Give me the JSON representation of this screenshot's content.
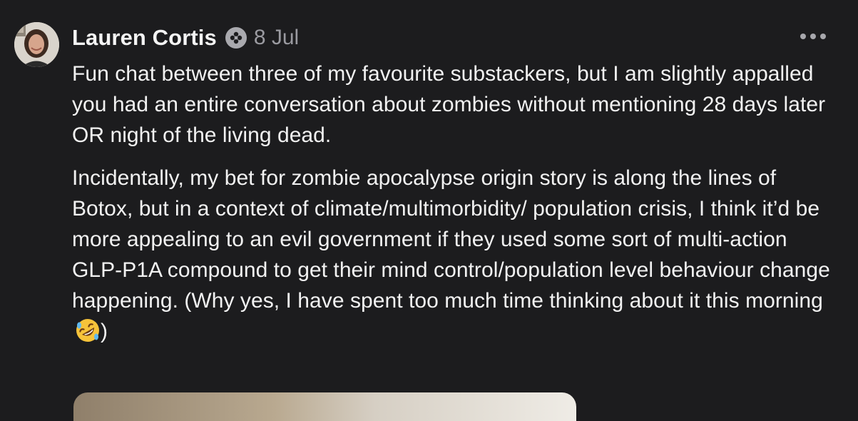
{
  "comment": {
    "author": "Lauren Cortis",
    "date": "8 Jul",
    "paragraphs": [
      "Fun chat between three of my favourite substackers, but I am slightly appalled you had an entire conversation about zombies without mentioning 28 days later OR night of the living dead.",
      "Incidentally, my bet for zombie apocalypse origin story is along the lines of Botox, but in a context of climate/multimorbidity/ population crisis, I think it’d be more appealing to an evil government if they used some sort of multi-action GLP-P1A compound to get their mind control/population level behaviour change happening. (Why yes, I have spent too much time thinking about it this morning"
    ],
    "closing": ")",
    "emoji": "rolling-on-floor-laughing",
    "badge_icon": "subscriber-badge-icon",
    "more_icon": "more-options-icon"
  },
  "colors": {
    "background": "#1c1c1e",
    "text": "#f2f2f2",
    "muted": "#9a9aa0",
    "badge": "#a9a9ae"
  }
}
